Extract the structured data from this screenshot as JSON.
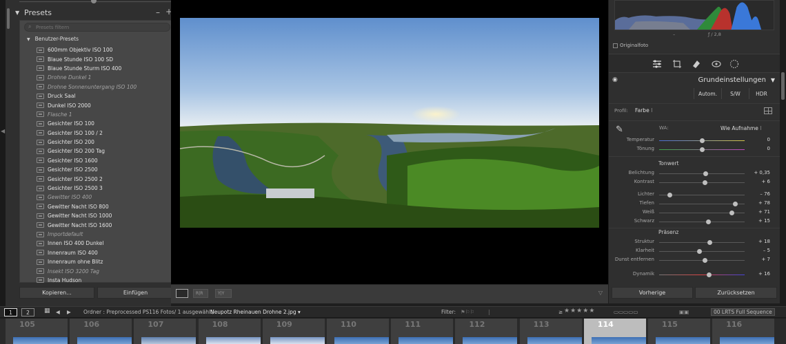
{
  "left_panel": {
    "presets_title": "Presets",
    "minus_label": "–",
    "plus_label": "+",
    "search_placeholder": "Presets filtern",
    "group_label": "Benutzer-Presets",
    "items": [
      {
        "label": "600mm Objektiv ISO 100",
        "dim": false
      },
      {
        "label": "Blaue Stunde ISO 100 SD",
        "dim": false
      },
      {
        "label": "Blaue Stunde Sturm ISO 400",
        "dim": false
      },
      {
        "label": "Drohne Dunkel 1",
        "dim": true
      },
      {
        "label": "Drohne Sonnenuntergang ISO 100",
        "dim": true
      },
      {
        "label": "Druck Saal",
        "dim": false
      },
      {
        "label": "Dunkel ISO 2000",
        "dim": false
      },
      {
        "label": "Flasche 1",
        "dim": true
      },
      {
        "label": "Gesichter ISO 100",
        "dim": false
      },
      {
        "label": "Gesichter ISO 100 / 2",
        "dim": false
      },
      {
        "label": "Gesichter ISO 200",
        "dim": false
      },
      {
        "label": "Gesichter ISO 200 Tag",
        "dim": false
      },
      {
        "label": "Gesichter ISO 1600",
        "dim": false
      },
      {
        "label": "Gesichter ISO 2500",
        "dim": false
      },
      {
        "label": "Gesichter ISO 2500 2",
        "dim": false
      },
      {
        "label": "Gesichter ISO 2500 3",
        "dim": false
      },
      {
        "label": "Gewitter ISO 400",
        "dim": true
      },
      {
        "label": "Gewitter Nacht ISO 800",
        "dim": false
      },
      {
        "label": "Gewitter Nacht ISO 1000",
        "dim": false
      },
      {
        "label": "Gewitter Nacht ISO 1600",
        "dim": false
      },
      {
        "label": "Importdefault",
        "dim": true
      },
      {
        "label": "Innen ISO 400 Dunkel",
        "dim": false
      },
      {
        "label": "Innenraum ISO 400",
        "dim": false
      },
      {
        "label": "Innenraum ohne Blitz",
        "dim": false
      },
      {
        "label": "Insekt ISO 3200 Tag",
        "dim": true
      },
      {
        "label": "Insta Hudson",
        "dim": false
      }
    ],
    "copy_button": "Kopieren...",
    "paste_button": "Einfügen"
  },
  "histogram": {
    "shutter": "–",
    "aperture": "ƒ / 2,8",
    "original_photo_label": "Originalfoto"
  },
  "develop": {
    "section_title": "Grundeinstellungen",
    "auto_button": "Autom.",
    "bw_button": "S/W",
    "hdr_button": "HDR",
    "profile_label": "Profil:",
    "profile_value": "Farbe",
    "wb_label": "WA:",
    "wb_value": "Wie Aufnahme",
    "tone_title": "Tonwert",
    "presence_title": "Präsenz",
    "sliders": [
      {
        "label": "Temperatur",
        "value": "0",
        "pos": 0.5
      },
      {
        "label": "Tönung",
        "value": "0",
        "pos": 0.5
      },
      {
        "label": "Belichtung",
        "value": "+ 0,35",
        "pos": 0.54
      },
      {
        "label": "Kontrast",
        "value": "+ 6",
        "pos": 0.53
      },
      {
        "label": "Lichter",
        "value": "– 76",
        "pos": 0.12
      },
      {
        "label": "Tiefen",
        "value": "+ 78",
        "pos": 0.89
      },
      {
        "label": "Weiß",
        "value": "+ 71",
        "pos": 0.85
      },
      {
        "label": "Schwarz",
        "value": "+ 15",
        "pos": 0.57
      },
      {
        "label": "Struktur",
        "value": "+ 18",
        "pos": 0.59
      },
      {
        "label": "Klarheit",
        "value": "– 5",
        "pos": 0.47
      },
      {
        "label": "Dunst entfernen",
        "value": "+ 7",
        "pos": 0.53
      },
      {
        "label": "Dynamik",
        "value": "+ 16",
        "pos": 0.58
      }
    ],
    "previous_button": "Vorherige",
    "reset_button": "Zurücksetzen"
  },
  "filmbar": {
    "view1": "1",
    "view2": "2",
    "folder_label": "Ordner : Preprocessed PS",
    "count_label": "116 Fotos/ 1 ausgewählt/",
    "file_name": "Neupotz Rheinauen Drohne 2.jpg",
    "filter_label": "Filter:",
    "stars_prefix": "≥",
    "preset_select": "00 LRTS Full Sequence"
  },
  "filmstrip": [
    {
      "num": "105",
      "selected": false,
      "sky": "a"
    },
    {
      "num": "106",
      "selected": false,
      "sky": "a"
    },
    {
      "num": "107",
      "selected": false,
      "sky": "b"
    },
    {
      "num": "108",
      "selected": false,
      "sky": "c"
    },
    {
      "num": "109",
      "selected": false,
      "sky": "c"
    },
    {
      "num": "110",
      "selected": false,
      "sky": "a"
    },
    {
      "num": "111",
      "selected": false,
      "sky": "a"
    },
    {
      "num": "112",
      "selected": false,
      "sky": "a"
    },
    {
      "num": "113",
      "selected": false,
      "sky": "a"
    },
    {
      "num": "114",
      "selected": true,
      "sky": "a"
    },
    {
      "num": "115",
      "selected": false,
      "sky": "a"
    },
    {
      "num": "116",
      "selected": false,
      "sky": "a"
    }
  ]
}
